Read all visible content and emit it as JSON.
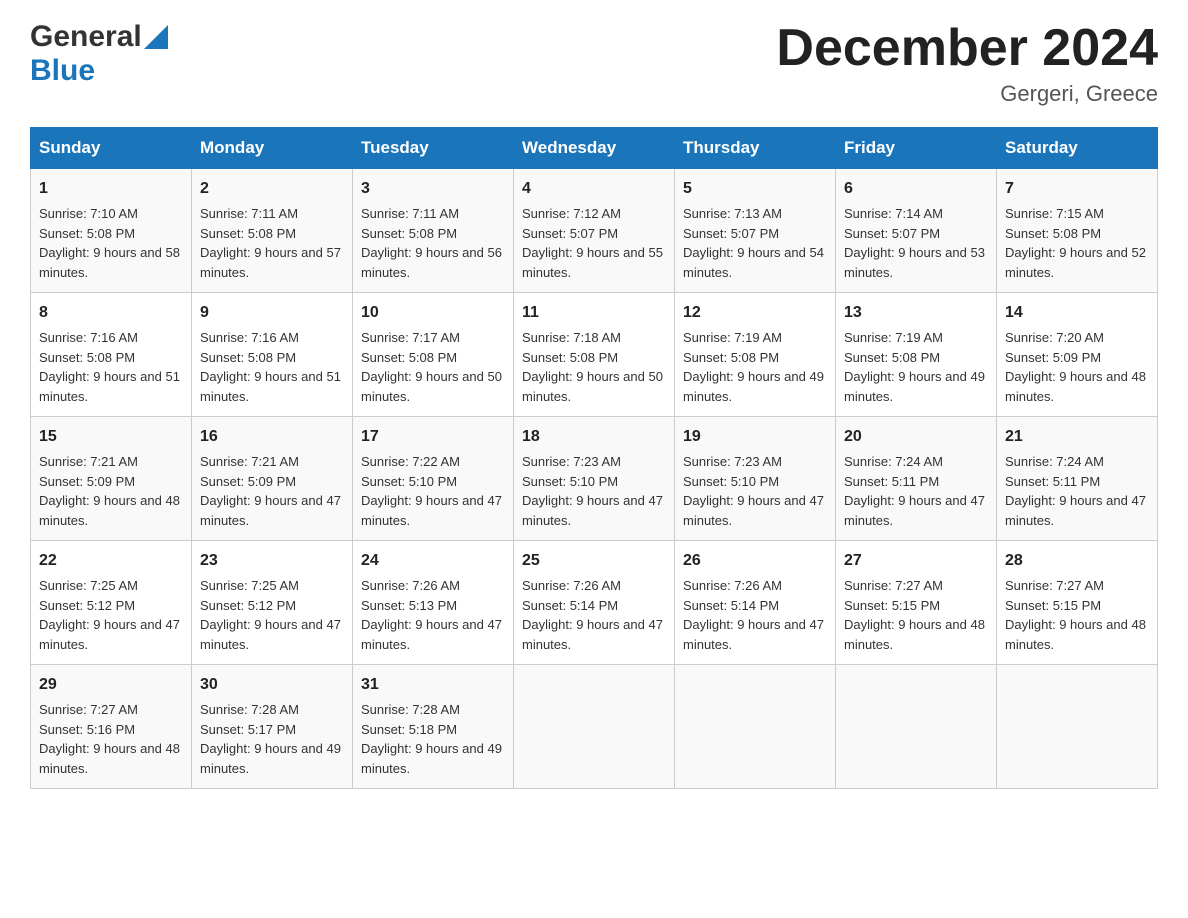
{
  "header": {
    "logo_general": "General",
    "logo_blue": "Blue",
    "month_title": "December 2024",
    "location": "Gergeri, Greece"
  },
  "weekdays": [
    "Sunday",
    "Monday",
    "Tuesday",
    "Wednesday",
    "Thursday",
    "Friday",
    "Saturday"
  ],
  "weeks": [
    [
      {
        "day": "1",
        "sunrise": "7:10 AM",
        "sunset": "5:08 PM",
        "daylight": "9 hours and 58 minutes."
      },
      {
        "day": "2",
        "sunrise": "7:11 AM",
        "sunset": "5:08 PM",
        "daylight": "9 hours and 57 minutes."
      },
      {
        "day": "3",
        "sunrise": "7:11 AM",
        "sunset": "5:08 PM",
        "daylight": "9 hours and 56 minutes."
      },
      {
        "day": "4",
        "sunrise": "7:12 AM",
        "sunset": "5:07 PM",
        "daylight": "9 hours and 55 minutes."
      },
      {
        "day": "5",
        "sunrise": "7:13 AM",
        "sunset": "5:07 PM",
        "daylight": "9 hours and 54 minutes."
      },
      {
        "day": "6",
        "sunrise": "7:14 AM",
        "sunset": "5:07 PM",
        "daylight": "9 hours and 53 minutes."
      },
      {
        "day": "7",
        "sunrise": "7:15 AM",
        "sunset": "5:08 PM",
        "daylight": "9 hours and 52 minutes."
      }
    ],
    [
      {
        "day": "8",
        "sunrise": "7:16 AM",
        "sunset": "5:08 PM",
        "daylight": "9 hours and 51 minutes."
      },
      {
        "day": "9",
        "sunrise": "7:16 AM",
        "sunset": "5:08 PM",
        "daylight": "9 hours and 51 minutes."
      },
      {
        "day": "10",
        "sunrise": "7:17 AM",
        "sunset": "5:08 PM",
        "daylight": "9 hours and 50 minutes."
      },
      {
        "day": "11",
        "sunrise": "7:18 AM",
        "sunset": "5:08 PM",
        "daylight": "9 hours and 50 minutes."
      },
      {
        "day": "12",
        "sunrise": "7:19 AM",
        "sunset": "5:08 PM",
        "daylight": "9 hours and 49 minutes."
      },
      {
        "day": "13",
        "sunrise": "7:19 AM",
        "sunset": "5:08 PM",
        "daylight": "9 hours and 49 minutes."
      },
      {
        "day": "14",
        "sunrise": "7:20 AM",
        "sunset": "5:09 PM",
        "daylight": "9 hours and 48 minutes."
      }
    ],
    [
      {
        "day": "15",
        "sunrise": "7:21 AM",
        "sunset": "5:09 PM",
        "daylight": "9 hours and 48 minutes."
      },
      {
        "day": "16",
        "sunrise": "7:21 AM",
        "sunset": "5:09 PM",
        "daylight": "9 hours and 47 minutes."
      },
      {
        "day": "17",
        "sunrise": "7:22 AM",
        "sunset": "5:10 PM",
        "daylight": "9 hours and 47 minutes."
      },
      {
        "day": "18",
        "sunrise": "7:23 AM",
        "sunset": "5:10 PM",
        "daylight": "9 hours and 47 minutes."
      },
      {
        "day": "19",
        "sunrise": "7:23 AM",
        "sunset": "5:10 PM",
        "daylight": "9 hours and 47 minutes."
      },
      {
        "day": "20",
        "sunrise": "7:24 AM",
        "sunset": "5:11 PM",
        "daylight": "9 hours and 47 minutes."
      },
      {
        "day": "21",
        "sunrise": "7:24 AM",
        "sunset": "5:11 PM",
        "daylight": "9 hours and 47 minutes."
      }
    ],
    [
      {
        "day": "22",
        "sunrise": "7:25 AM",
        "sunset": "5:12 PM",
        "daylight": "9 hours and 47 minutes."
      },
      {
        "day": "23",
        "sunrise": "7:25 AM",
        "sunset": "5:12 PM",
        "daylight": "9 hours and 47 minutes."
      },
      {
        "day": "24",
        "sunrise": "7:26 AM",
        "sunset": "5:13 PM",
        "daylight": "9 hours and 47 minutes."
      },
      {
        "day": "25",
        "sunrise": "7:26 AM",
        "sunset": "5:14 PM",
        "daylight": "9 hours and 47 minutes."
      },
      {
        "day": "26",
        "sunrise": "7:26 AM",
        "sunset": "5:14 PM",
        "daylight": "9 hours and 47 minutes."
      },
      {
        "day": "27",
        "sunrise": "7:27 AM",
        "sunset": "5:15 PM",
        "daylight": "9 hours and 48 minutes."
      },
      {
        "day": "28",
        "sunrise": "7:27 AM",
        "sunset": "5:15 PM",
        "daylight": "9 hours and 48 minutes."
      }
    ],
    [
      {
        "day": "29",
        "sunrise": "7:27 AM",
        "sunset": "5:16 PM",
        "daylight": "9 hours and 48 minutes."
      },
      {
        "day": "30",
        "sunrise": "7:28 AM",
        "sunset": "5:17 PM",
        "daylight": "9 hours and 49 minutes."
      },
      {
        "day": "31",
        "sunrise": "7:28 AM",
        "sunset": "5:18 PM",
        "daylight": "9 hours and 49 minutes."
      },
      null,
      null,
      null,
      null
    ]
  ]
}
